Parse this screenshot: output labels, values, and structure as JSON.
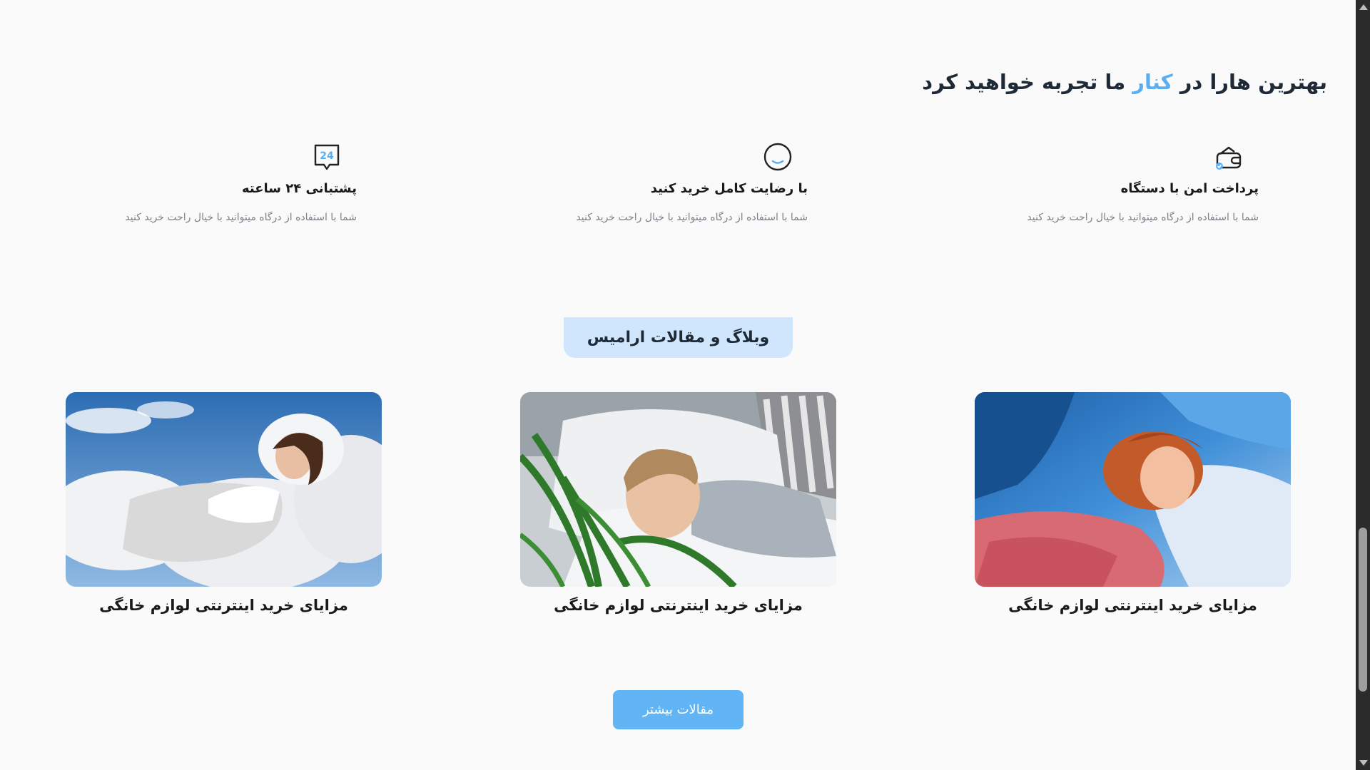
{
  "headline": {
    "part1": "بهترین هارا در ",
    "accent": "کنار",
    "part2": " ما تجربه خواهید کرد"
  },
  "features": [
    {
      "title": "پرداخت امن با دستگاه",
      "desc": "شما با استفاده از درگاه میتوانید با خیال راحت خرید کنید",
      "icon": "wallet-icon"
    },
    {
      "title": "با رضایت کامل خرید کنید",
      "desc": "شما با استفاده از درگاه میتوانید با خیال راحت خرید کنید",
      "icon": "smile-icon"
    },
    {
      "title": "پشتبانی ۲۴ ساعته",
      "desc": "شما با استفاده از درگاه میتوانید با خیال راحت خرید کنید",
      "icon": "support-24-icon",
      "icon_text": "24"
    }
  ],
  "blog": {
    "title": "وبلاگ و مقالات ارامیس",
    "cards": [
      {
        "caption": "مزایای خرید اینترنتی لوازم خانگی"
      },
      {
        "caption": "مزایای خرید اینترنتی لوازم خانگی"
      },
      {
        "caption": "مزایای خرید اینترنتی لوازم خانگی"
      }
    ],
    "more_label": "مقالات بیشتر"
  },
  "colors": {
    "accent": "#5aaef2",
    "pill_bg": "#cfe6fd",
    "button_bg": "#61b5f5"
  }
}
